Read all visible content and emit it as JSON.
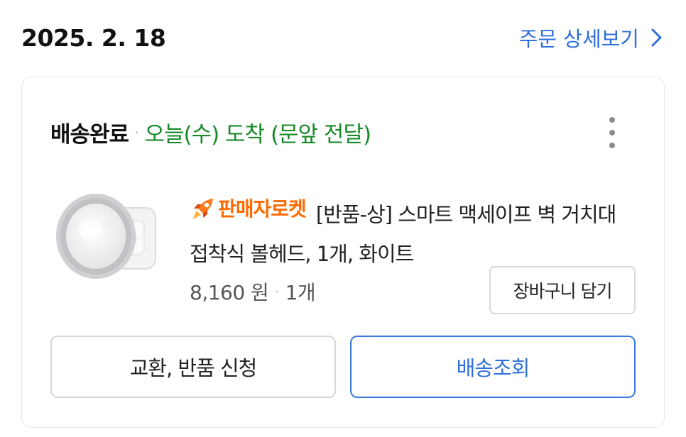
{
  "order": {
    "date": "2025. 2. 18",
    "detail_link": "주문 상세보기"
  },
  "delivery": {
    "status": "배송완료",
    "separator": "·",
    "eta": "오늘(수) 도착 (문앞 전달)"
  },
  "product": {
    "seller_badge": "판매자로켓",
    "title": "[반품-상] 스마트 맥세이프 벽 거치대 접착식 볼헤드, 1개, 화이트",
    "price": "8,160 원",
    "separator": "·",
    "quantity": "1개",
    "cart_button": "장바구니 담기"
  },
  "actions": {
    "exchange_return": "교환, 반품 신청",
    "track_delivery": "배송조회"
  },
  "colors": {
    "link_blue": "#2f6fd8",
    "eta_green": "#188a2a",
    "seller_orange": "#ff6a00"
  },
  "icons": {
    "detail_arrow": "chevron-right-icon",
    "more": "more-vertical-icon",
    "seller_badge": "rocket-icon"
  }
}
